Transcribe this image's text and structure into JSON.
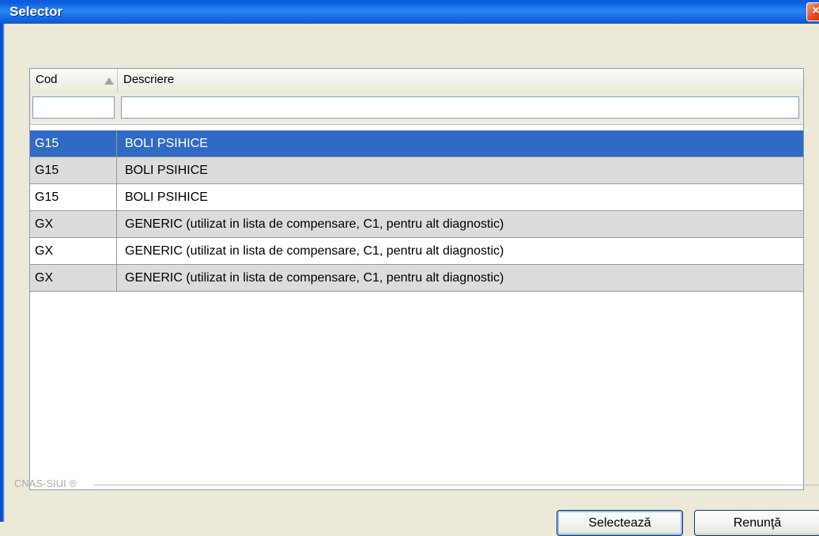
{
  "window": {
    "title": "Selector",
    "close_glyph": "×"
  },
  "grid": {
    "columns": [
      {
        "label": "Cod",
        "sort": "ascending"
      },
      {
        "label": "Descriere"
      }
    ],
    "filters": {
      "cod": "",
      "descriere": ""
    },
    "rows": [
      {
        "cod": "G15",
        "descriere": "BOLI PSIHICE",
        "state": "selected"
      },
      {
        "cod": "G15",
        "descriere": "BOLI PSIHICE",
        "state": "alt"
      },
      {
        "cod": "G15",
        "descriere": "BOLI PSIHICE",
        "state": "white"
      },
      {
        "cod": "GX",
        "descriere": "GENERIC (utilizat in lista de compensare, C1, pentru alt diagnostic)",
        "state": "alt"
      },
      {
        "cod": "GX",
        "descriere": "GENERIC (utilizat in lista de compensare, C1, pentru alt diagnostic)",
        "state": "white"
      },
      {
        "cod": "GX",
        "descriere": "GENERIC (utilizat in lista de compensare, C1, pentru alt diagnostic)",
        "state": "alt"
      }
    ]
  },
  "footer": {
    "brand": "CNAS-SIUI ®",
    "select_label": "Selectează",
    "cancel_label": "Renunţă"
  },
  "colors": {
    "selection": "#316ac5",
    "titlebar": "#0b5ce0"
  }
}
